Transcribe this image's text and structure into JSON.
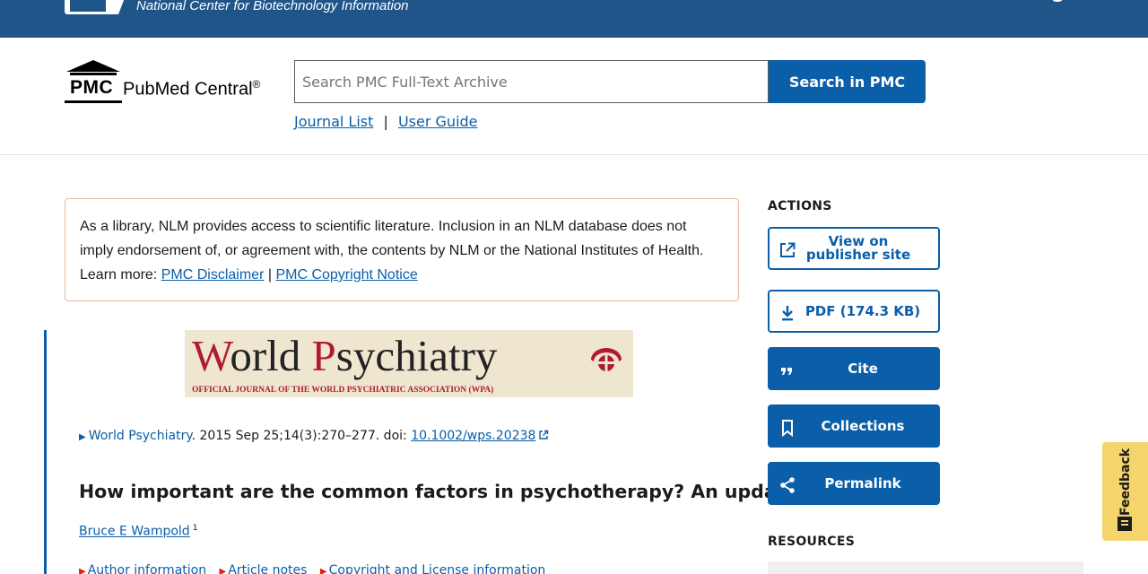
{
  "ncbi_banner": {
    "org_name": "National Center for Biotechnology Information",
    "color": "#20558a"
  },
  "header": {
    "logo_abbr": "PMC",
    "logo_name": "PubMed Central",
    "logo_reg": "®",
    "search": {
      "placeholder": "Search PMC Full-Text Archive",
      "value": ""
    },
    "search_button": "Search in PMC",
    "links": [
      {
        "label": "Journal List"
      },
      {
        "label": "User Guide"
      }
    ],
    "link_separator": "|"
  },
  "disclaimer": {
    "text": "As a library, NLM provides access to scientific literature. Inclusion in an NLM database does not imply endorsement of, or agreement with, the contents by NLM or the National Institutes of Health.",
    "learn_more": "Learn more:",
    "links": [
      {
        "label": "PMC Disclaimer"
      },
      {
        "label": "PMC Copyright Notice"
      }
    ],
    "separator": "|",
    "border_color": "#e9b69b"
  },
  "journal_banner": {
    "title_cap_1": "W",
    "title_rest_1": "orld ",
    "title_cap_2": "P",
    "title_rest_2": "sychiatry",
    "subtitle": "OFFICIAL JOURNAL OF THE WORLD PSYCHIATRIC ASSOCIATION (WPA)"
  },
  "article": {
    "journal_name": "World Psychiatry",
    "citation_text": ". 2015 Sep 25;14(3):270–277. doi: ",
    "doi": "10.1002/wps.20238",
    "title": "How important are the common factors in psychotherapy? An update",
    "author": {
      "name": "Bruce E Wampold",
      "affiliation": "1"
    },
    "tabs": [
      {
        "label": "Author information"
      },
      {
        "label": "Article notes"
      },
      {
        "label": "Copyright and License information"
      }
    ]
  },
  "sidebar": {
    "actions_label": "ACTIONS",
    "actions": [
      {
        "label": "View on publisher site",
        "icon": "external-link-icon",
        "style": "outline"
      },
      {
        "label": "PDF (174.3 KB)",
        "icon": "download-icon",
        "style": "outline"
      },
      {
        "label": "Cite",
        "icon": "quote-icon",
        "style": "solid"
      },
      {
        "label": "Collections",
        "icon": "bookmark-icon",
        "style": "solid"
      },
      {
        "label": "Permalink",
        "icon": "share-icon",
        "style": "solid"
      }
    ],
    "resources_label": "RESOURCES"
  },
  "feedback": {
    "label": "Feedback",
    "color": "#f5d56b"
  },
  "colors": {
    "primary": "#0b5ea8",
    "header_bg": "#20558a"
  }
}
